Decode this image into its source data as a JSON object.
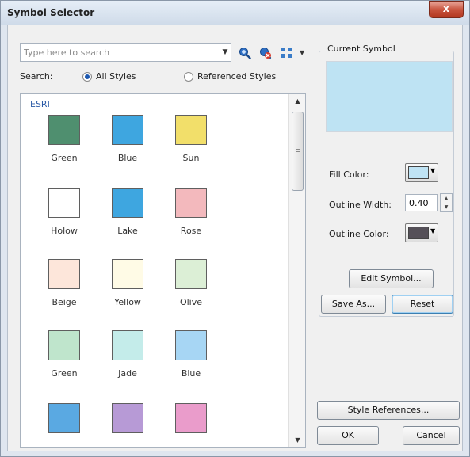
{
  "window": {
    "title": "Symbol Selector",
    "close_glyph": "x"
  },
  "search": {
    "placeholder": "Type here to search",
    "label": "Search:",
    "scope_options": [
      {
        "label": "All Styles",
        "selected": true
      },
      {
        "label": "Referenced Styles",
        "selected": false
      }
    ]
  },
  "symbol_list": {
    "group_name": "ESRI",
    "symbols": [
      {
        "name": "Green",
        "color": "#4f8f6f"
      },
      {
        "name": "Blue",
        "color": "#3ea6e0"
      },
      {
        "name": "Sun",
        "color": "#f2df6a"
      },
      {
        "name": "Holow",
        "color": "#ffffff"
      },
      {
        "name": "Lake",
        "color": "#3ea6e0"
      },
      {
        "name": "Rose",
        "color": "#f3b9bd"
      },
      {
        "name": "Beige",
        "color": "#fde6da"
      },
      {
        "name": "Yellow",
        "color": "#fffbe6"
      },
      {
        "name": "Olive",
        "color": "#dcefd6"
      },
      {
        "name": "Green",
        "color": "#bfe5cc"
      },
      {
        "name": "Jade",
        "color": "#c4ecea"
      },
      {
        "name": "Blue",
        "color": "#a7d6f4"
      },
      {
        "name": "",
        "color": "#5aa9e2"
      },
      {
        "name": "",
        "color": "#b79ad6"
      },
      {
        "name": "",
        "color": "#ea9ccb"
      }
    ]
  },
  "current_symbol": {
    "title": "Current Symbol",
    "preview_color": "#bee3f3",
    "fill_color_label": "Fill Color:",
    "fill_color": "#bfe3f4",
    "outline_width_label": "Outline Width:",
    "outline_width": "0.40",
    "outline_color_label": "Outline Color:",
    "outline_color": "#555058"
  },
  "buttons": {
    "edit_symbol": "Edit Symbol...",
    "save_as": "Save As...",
    "reset": "Reset",
    "style_references": "Style References...",
    "ok": "OK",
    "cancel": "Cancel"
  }
}
